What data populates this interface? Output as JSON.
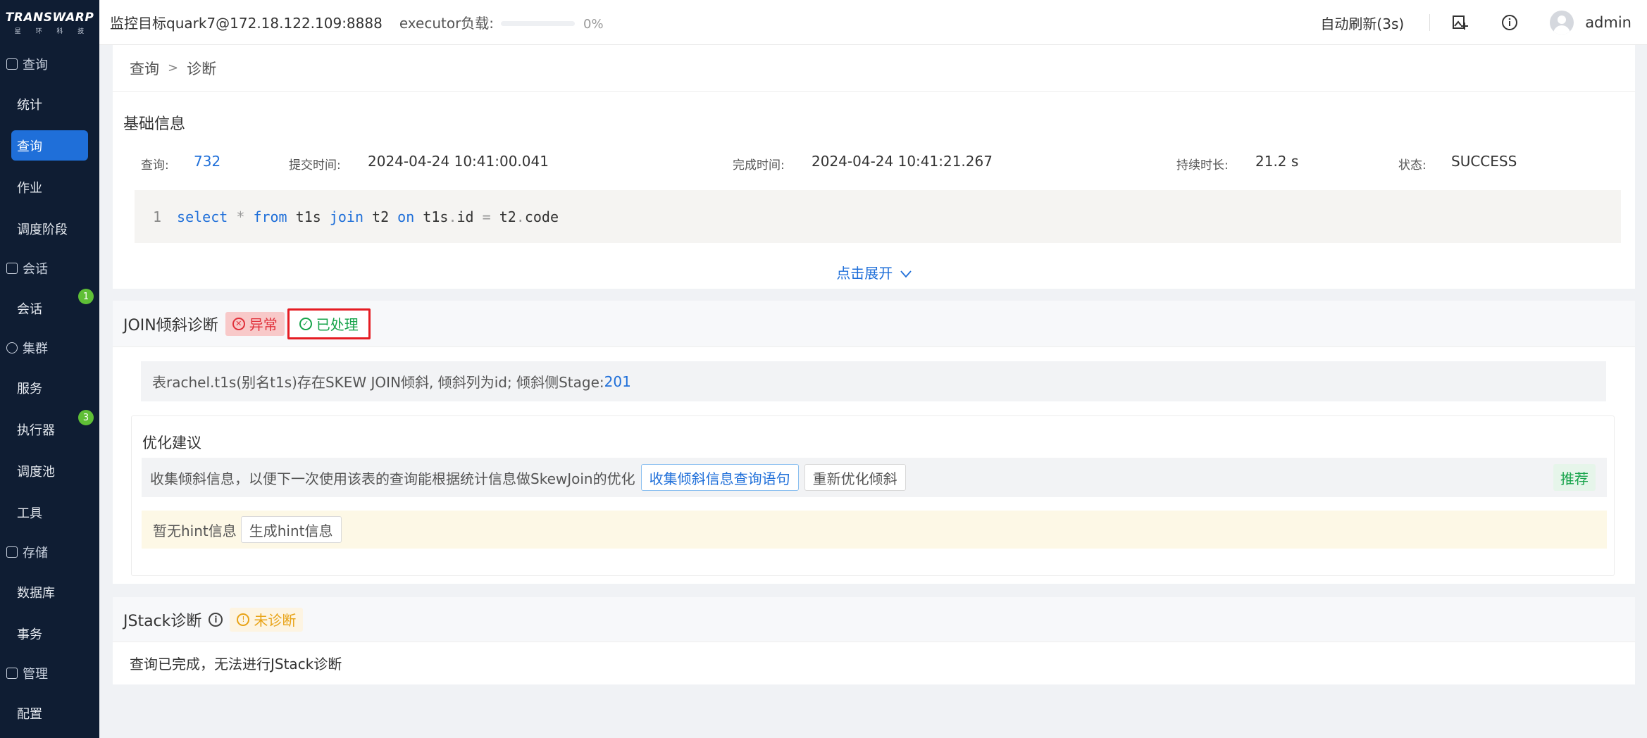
{
  "logo": {
    "main": "TRANSWARP",
    "sub": "星 环 科 技"
  },
  "sidebar": {
    "groups": [
      {
        "label": "查询",
        "icon": "terminal-icon",
        "items": [
          {
            "label": "统计"
          },
          {
            "label": "查询",
            "active": true
          },
          {
            "label": "作业"
          },
          {
            "label": "调度阶段"
          }
        ]
      },
      {
        "label": "会话",
        "icon": "session-icon",
        "items": [
          {
            "label": "会话",
            "badge": "1"
          }
        ]
      },
      {
        "label": "集群",
        "icon": "globe-icon",
        "items": [
          {
            "label": "服务"
          },
          {
            "label": "执行器",
            "badge": "3"
          },
          {
            "label": "调度池"
          },
          {
            "label": "工具"
          }
        ]
      },
      {
        "label": "存储",
        "icon": "storage-icon",
        "items": [
          {
            "label": "数据库"
          },
          {
            "label": "事务"
          }
        ]
      },
      {
        "label": "管理",
        "icon": "admin-icon",
        "items": [
          {
            "label": "配置"
          }
        ]
      }
    ]
  },
  "topbar": {
    "monitor": "监控目标quark7@172.18.122.109:8888",
    "executor_label": "executor负载:",
    "executor_pct_value": 0,
    "executor_pct": "0%",
    "refresh": "自动刷新(3s)",
    "user": "admin"
  },
  "breadcrumb": {
    "parent": "查询",
    "sep": ">",
    "current": "诊断"
  },
  "basic": {
    "title": "基础信息",
    "query_label": "查询:",
    "query_value": "732",
    "submit_label": "提交时间:",
    "submit_value": "2024-04-24 10:41:00.041",
    "finish_label": "完成时间:",
    "finish_value": "2024-04-24 10:41:21.267",
    "duration_label": "持续时长:",
    "duration_value": "21.2 s",
    "status_label": "状态:",
    "status_value": "SUCCESS",
    "code_line": "1",
    "expand": "点击展开"
  },
  "sql_tokens": [
    {
      "t": "select",
      "c": "kw"
    },
    {
      "t": " "
    },
    {
      "t": "*",
      "c": "op"
    },
    {
      "t": " "
    },
    {
      "t": "from",
      "c": "kw"
    },
    {
      "t": " t1s "
    },
    {
      "t": "join",
      "c": "kw"
    },
    {
      "t": " t2 "
    },
    {
      "t": "on",
      "c": "kw"
    },
    {
      "t": " t1s"
    },
    {
      "t": ".",
      "c": "op"
    },
    {
      "t": "id "
    },
    {
      "t": "=",
      "c": "op"
    },
    {
      "t": " t2"
    },
    {
      "t": ".",
      "c": "op"
    },
    {
      "t": "code"
    }
  ],
  "join": {
    "title": "JOIN倾斜诊断",
    "tag_abnormal": "异常",
    "tag_handled": "已处理",
    "message": "表rachel.t1s(别名t1s)存在SKEW JOIN倾斜, 倾斜列为id;  倾斜侧Stage:",
    "stage": "201",
    "suggest_title": "优化建议",
    "suggest_text": "收集倾斜信息，以便下一次使用该表的查询能根据统计信息做SkewJoin的优化",
    "btn_collect": "收集倾斜信息查询语句",
    "btn_reopt": "重新优化倾斜",
    "recommend": "推荐",
    "hint_text": "暂无hint信息",
    "btn_hint": "生成hint信息"
  },
  "jstack": {
    "title": "JStack诊断",
    "tag": "未诊断",
    "message": "查询已完成，无法进行JStack诊断"
  },
  "colors": {
    "accent": "#1f6fd9",
    "sidebar_bg": "#0f1d33",
    "success": "#16a34a",
    "error": "#e0303a",
    "warning": "#e8a317",
    "highlight_border": "#e51c23"
  }
}
